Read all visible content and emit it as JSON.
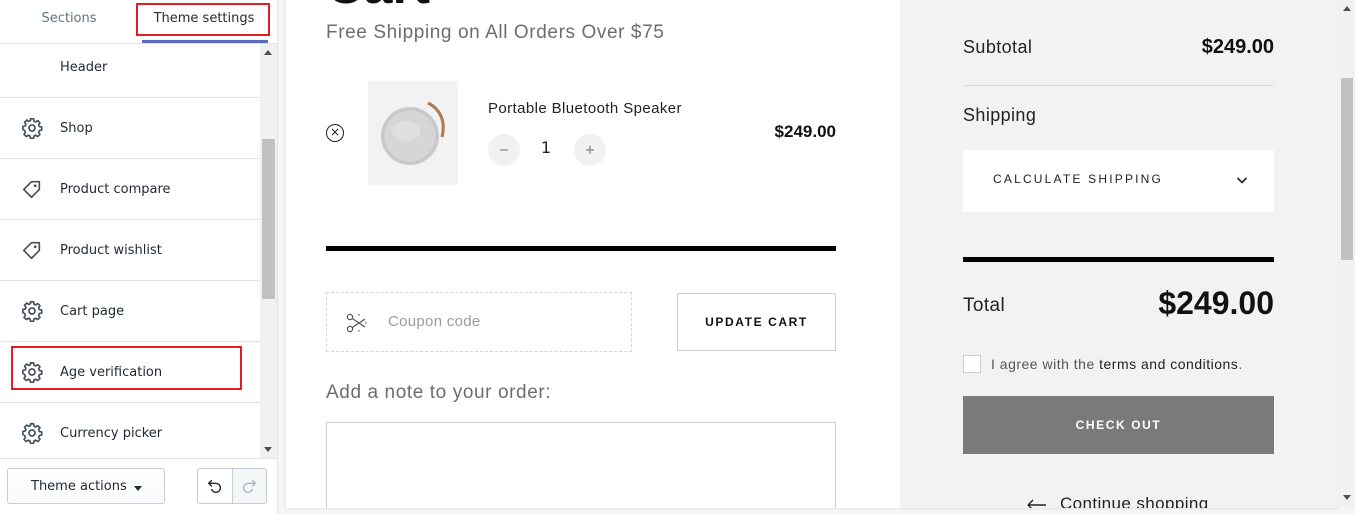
{
  "editor": {
    "tabs": {
      "sections": "Sections",
      "theme_settings": "Theme settings"
    },
    "items": [
      {
        "label": "Header",
        "icon": "none"
      },
      {
        "label": "Shop",
        "icon": "gear-icon"
      },
      {
        "label": "Product compare",
        "icon": "tag-icon"
      },
      {
        "label": "Product wishlist",
        "icon": "tag-icon"
      },
      {
        "label": "Cart page",
        "icon": "gear-icon"
      },
      {
        "label": "Age verification",
        "icon": "gear-icon"
      },
      {
        "label": "Currency picker",
        "icon": "gear-icon"
      }
    ],
    "footer": {
      "theme_actions": "Theme actions"
    },
    "highlight_color": "#e02020",
    "accent_color": "#5c6ac4"
  },
  "cart": {
    "title": "Cart",
    "free_shipping": "Free Shipping on All Orders Over $75",
    "item": {
      "name": "Portable Bluetooth Speaker",
      "quantity": "1",
      "price": "$249.00",
      "minus": "−",
      "plus": "+",
      "remove": "×"
    },
    "coupon_placeholder": "Coupon code",
    "update_cart": "UPDATE CART",
    "note_label": "Add a note to your order:"
  },
  "summary": {
    "subtotal_label": "Subtotal",
    "subtotal_value": "$249.00",
    "shipping_label": "Shipping",
    "calculate_shipping": "CALCULATE SHIPPING",
    "total_label": "Total",
    "total_value": "$249.00",
    "agree_prefix": "I agree with the",
    "agree_link": "terms and conditions",
    "agree_suffix": ".",
    "checkout": "CHECK OUT",
    "continue": "Continue shopping"
  }
}
